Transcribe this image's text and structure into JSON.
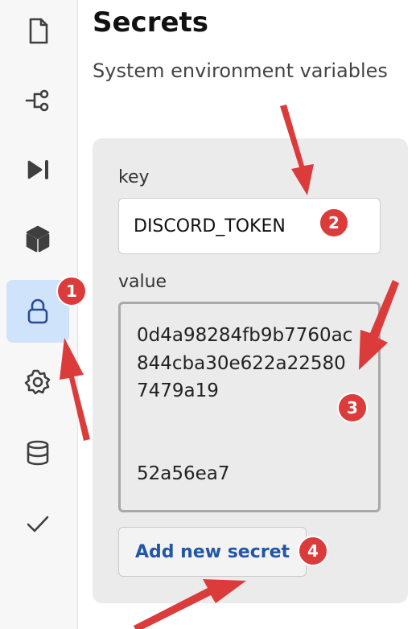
{
  "sidebar": {
    "items": [
      {
        "icon": "file-icon"
      },
      {
        "icon": "flow-icon"
      },
      {
        "icon": "skip-forward-icon"
      },
      {
        "icon": "cube-icon"
      },
      {
        "icon": "lock-icon",
        "active": true
      },
      {
        "icon": "gear-icon"
      },
      {
        "icon": "database-icon"
      },
      {
        "icon": "check-icon"
      }
    ]
  },
  "header": {
    "title": "Secrets",
    "subtitle": "System environment variables"
  },
  "form": {
    "key_label": "key",
    "key_value": "DISCORD_TOKEN",
    "value_label": "value",
    "value_text": "0d4a98284fb9b7760ac844cba30e622a225807479a19",
    "value_partial_last_line": "52a56ea7",
    "add_button_label": "Add new secret"
  },
  "annotations": {
    "color": "#dc3b3b",
    "badges": [
      "1",
      "2",
      "3",
      "4"
    ]
  }
}
